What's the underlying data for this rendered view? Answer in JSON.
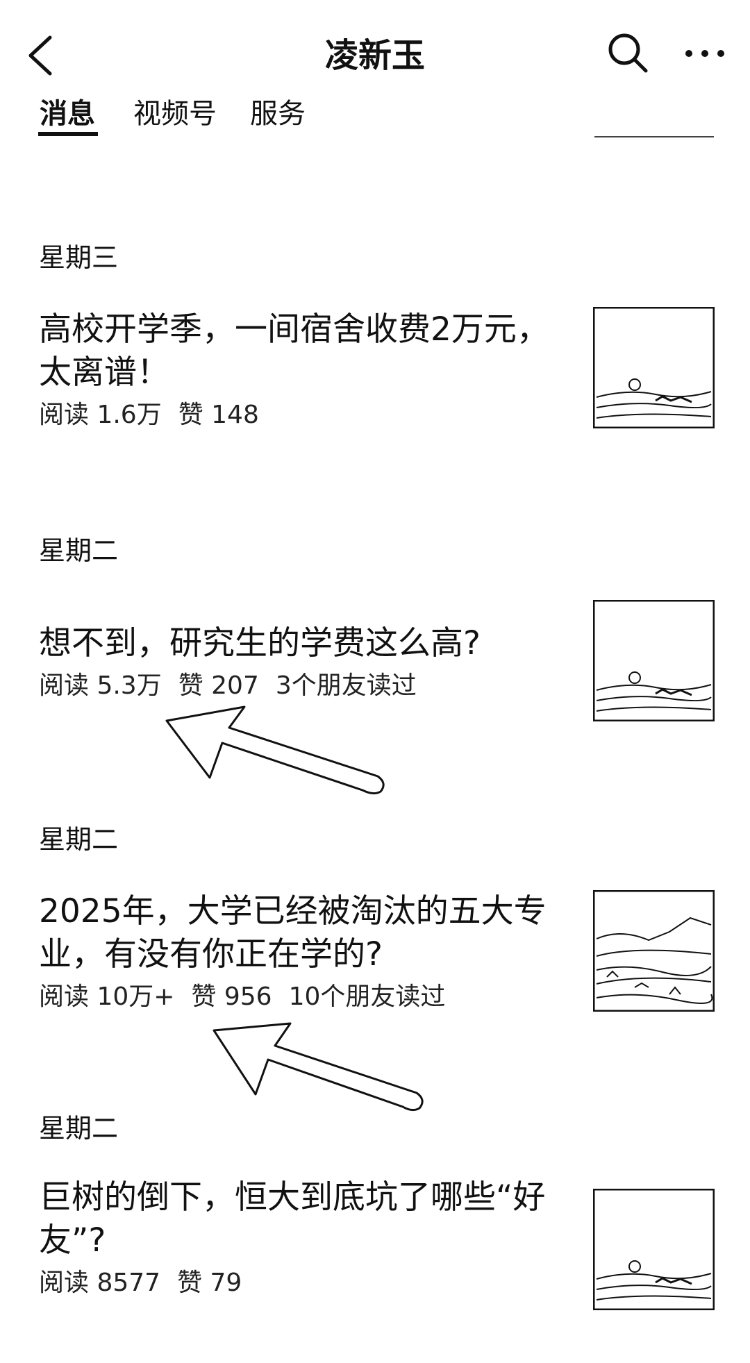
{
  "header": {
    "title": "凌新玉"
  },
  "tabs": [
    {
      "label": "消息",
      "active": true
    },
    {
      "label": "视频号",
      "active": false
    },
    {
      "label": "服务",
      "active": false
    }
  ],
  "articles": [
    {
      "day": "星期三",
      "title": "高校开学季，一间宿舍收费2万元，太离谱！",
      "reads": "阅读 1.6万",
      "likes": "赞 148",
      "friends": ""
    },
    {
      "day": "星期二",
      "title": "想不到，研究生的学费这么高?",
      "reads": "阅读 5.3万",
      "likes": "赞 207",
      "friends": "3个朋友读过"
    },
    {
      "day": "星期二",
      "title": "2025年，大学已经被淘汰的五大专业，有没有你正在学的?",
      "reads": "阅读 10万+",
      "likes": "赞 956",
      "friends": "10个朋友读过"
    },
    {
      "day": "星期二",
      "title": "巨树的倒下，恒大到底坑了哪些“好友”?",
      "reads": "阅读 8577",
      "likes": "赞 79",
      "friends": ""
    }
  ],
  "icons": {
    "back": "chevron-left-icon",
    "search": "search-icon",
    "more": "more-dots-icon",
    "annotation": "arrow-annotation-icon"
  }
}
